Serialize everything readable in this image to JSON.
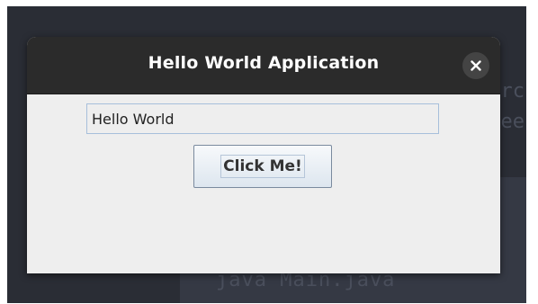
{
  "window": {
    "title": "Hello World Application",
    "close_icon": "close-icon"
  },
  "form": {
    "text_value": "Hello World",
    "button_label": "Click Me!"
  },
  "background": {
    "terminal_command": "java Main.java",
    "right_glyphs": [
      "rc",
      "ee"
    ]
  },
  "colors": {
    "desktop": "#2a2d35",
    "titlebar": "#2b2b2b",
    "window_body": "#eeeeee",
    "field_border": "#a7bfdb",
    "button_border": "#7a8a9e"
  }
}
